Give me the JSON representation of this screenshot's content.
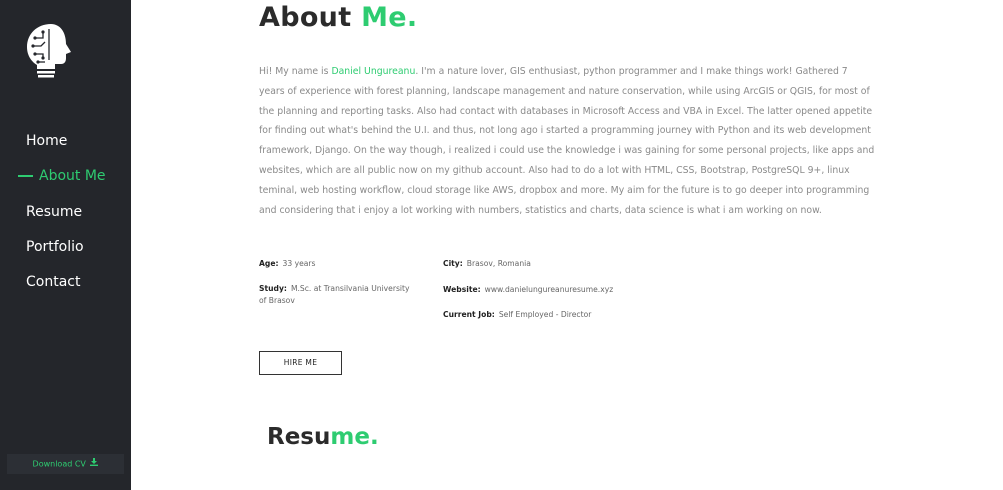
{
  "sidebar": {
    "nav": [
      {
        "label": "Home"
      },
      {
        "label": "About Me"
      },
      {
        "label": "Resume"
      },
      {
        "label": "Portfolio"
      },
      {
        "label": "Contact"
      }
    ],
    "download_label": "Download CV",
    "download_icon": "download-icon"
  },
  "about": {
    "title_main": "About",
    "title_accent": "Me.",
    "bio_intro": "Hi! My name is ",
    "bio_name": "Daniel Ungureanu",
    "bio_rest": ". I'm a nature lover, GIS enthusiast, python programmer and I make things work! Gathered 7 years of experience with forest planning, landscape management and nature conservation, while using ArcGIS or QGIS, for most of the planning and reporting tasks. Also had contact with databases in Microsoft Access and VBA in Excel. The latter opened appetite for finding out what's behind the U.I. and thus, not long ago i started a programming journey with Python and its web development framework, Django. On the way though, i realized i could use the knowledge i was gaining for some personal projects, like apps and websites, which are all public now on my github account. Also had to do a lot with HTML, CSS, Bootstrap, PostgreSQL 9+, linux teminal, web hosting workflow, cloud storage like AWS, dropbox and more. My aim for the future is to go deeper into programming and considering that i enjoy a lot working with numbers, statistics and charts, data science is what i am working on now.",
    "age_label": "Age:",
    "age_value": "33 years",
    "study_label": "Study:",
    "study_value": "M.Sc. at Transilvania University of Brasov",
    "city_label": "City:",
    "city_value": "Brasov, Romania",
    "website_label": "Website:",
    "website_value": "www.danielungureanuresume.xyz",
    "job_label": "Current Job:",
    "job_value": "Self Employed - Director",
    "hire_label": "HIRE ME"
  },
  "resume": {
    "title_main": "Resu",
    "title_accent": "me."
  },
  "colors": {
    "accent": "#2ecc71",
    "sidebar_bg": "#24262b",
    "heading": "#2b2b2b",
    "body_text": "#8a8a8a"
  }
}
